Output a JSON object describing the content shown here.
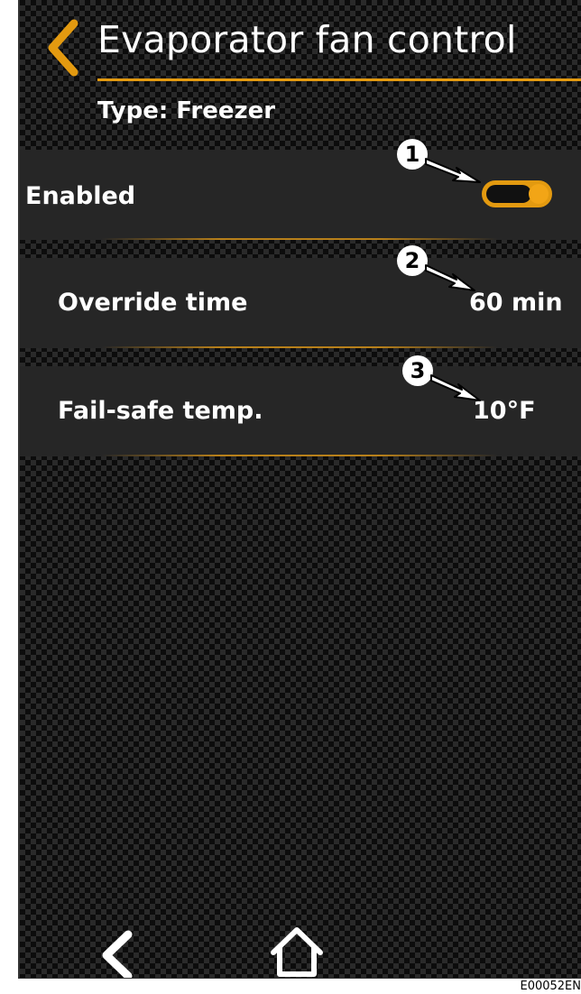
{
  "header": {
    "title": "Evaporator fan control"
  },
  "subtitle": "Type: Freezer",
  "settings": [
    {
      "label": "Enabled",
      "value": "",
      "toggle_on": true
    },
    {
      "label": "Override time",
      "value": "60 min"
    },
    {
      "label": "Fail-safe temp.",
      "value": "10°F"
    }
  ],
  "callouts": [
    "1",
    "2",
    "3"
  ],
  "figure_ref": "E00052EN",
  "colors": {
    "accent": "#e39a10",
    "row_bg": "#262626",
    "text": "#ffffff"
  },
  "icons": {
    "back": "chevron-left-icon",
    "nav_back": "chevron-left-icon",
    "nav_home": "home-icon"
  }
}
